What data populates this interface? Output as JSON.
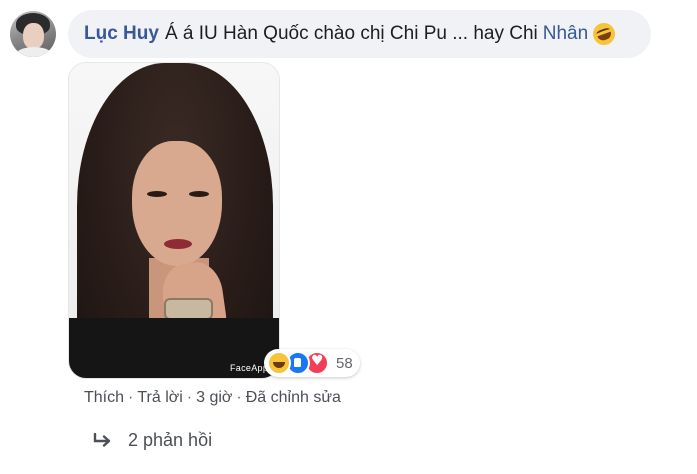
{
  "comment": {
    "author": "Lục Huy",
    "text": "Á á IU Hàn Quốc chào chị Chi Pu ... hay Chi",
    "tagged_name": "Nhân",
    "emoji": "rolling-on-floor-laughing-emoji"
  },
  "photo": {
    "watermark": "FaceApp"
  },
  "reactions": {
    "types": [
      "haha",
      "like",
      "love"
    ],
    "count": "58",
    "colors": {
      "haha": "#f7c33b",
      "like": "#1877f2",
      "love": "#f33e58"
    }
  },
  "actions": {
    "like": "Thích",
    "reply": "Trả lời",
    "time": "3 giờ",
    "edited": "Đã chỉnh sửa",
    "separator": "·"
  },
  "replies": {
    "label": "2 phản hồi"
  },
  "colors": {
    "name_link": "#385898",
    "bubble_bg": "#f0f2f5",
    "meta_text": "#65676b"
  }
}
